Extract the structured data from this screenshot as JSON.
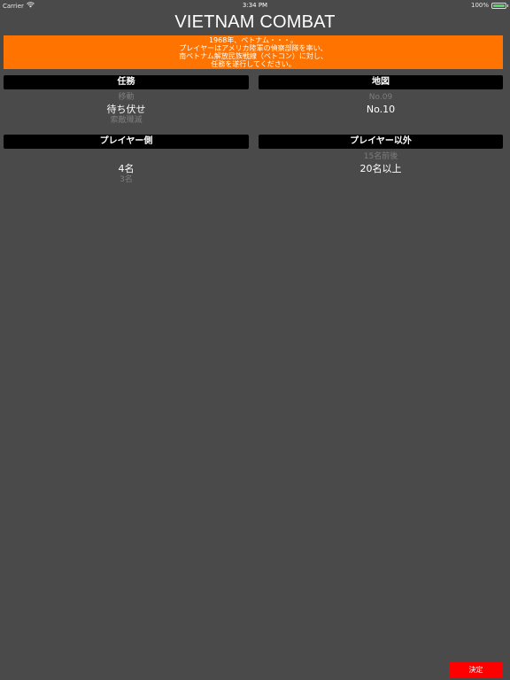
{
  "status_bar": {
    "carrier": "Carrier",
    "wifi_icon": "wifi-icon",
    "time": "3:34 PM",
    "battery_percent": "100%",
    "battery_level": 1.0,
    "battery_color": "#4cd964"
  },
  "app": {
    "title": "VIETNAM COMBAT",
    "intro_lines": [
      "1968年、ベトナム・・・。",
      "プレイヤーはアメリカ陸軍の偵察部隊を率い、",
      "南ベトナム解放民族戦線（ベトコン）に対し、",
      "任務を遂行してください。"
    ],
    "accent_color": "#ff7400",
    "confirm_color": "#ff0000"
  },
  "mission": {
    "header": "任務",
    "options": [
      "移動",
      "待ち伏せ",
      "索敵殲滅"
    ],
    "selected": "待ち伏せ"
  },
  "map": {
    "header": "地図",
    "options": [
      "No.09",
      "No.10"
    ],
    "selected": "No.10"
  },
  "player_side": {
    "header": "プレイヤー側",
    "options": [
      "4名",
      "3名"
    ],
    "selected": "4名"
  },
  "non_player": {
    "header": "プレイヤー以外",
    "options": [
      "15名前後",
      "20名以上"
    ],
    "selected": "20名以上"
  },
  "confirm_button": "決定"
}
